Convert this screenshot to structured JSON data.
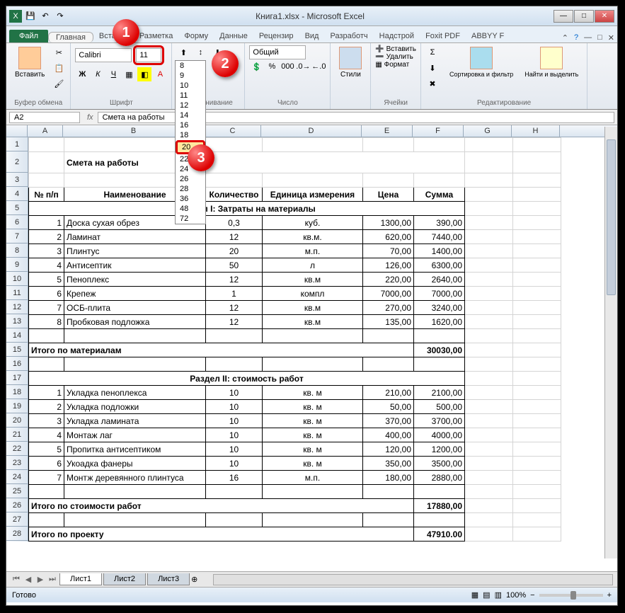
{
  "title": "Книга1.xlsx - Microsoft Excel",
  "tabs": {
    "file": "Файл",
    "home": "Главная",
    "insert": "Вставка",
    "layout": "Разметка",
    "formulas": "Форму",
    "data": "Данные",
    "review": "Рецензир",
    "view": "Вид",
    "dev": "Разработч",
    "addins": "Надстрой",
    "foxit": "Foxit PDF",
    "abbyy": "ABBYY F"
  },
  "ribbon": {
    "clipboard": {
      "label": "Буфер обмена",
      "paste": "Вставить"
    },
    "font": {
      "label": "Шрифт",
      "name": "Calibri",
      "size": "11"
    },
    "align": {
      "label": "Выравнивание"
    },
    "number": {
      "label": "Число",
      "format": "Общий"
    },
    "styles": {
      "label": "Стили"
    },
    "cells": {
      "label": "Ячейки",
      "insert": "Вставить",
      "delete": "Удалить",
      "format": "Формат"
    },
    "editing": {
      "label": "Редактирование",
      "sort": "Сортировка и фильтр",
      "find": "Найти и выделить"
    }
  },
  "font_sizes": [
    "8",
    "9",
    "10",
    "11",
    "12",
    "14",
    "16",
    "18",
    "20",
    "22",
    "24",
    "26",
    "28",
    "36",
    "48",
    "72"
  ],
  "selected_size": "20",
  "namebox": "A2",
  "formula": "Смета на работы",
  "columns": [
    "A",
    "B",
    "C",
    "D",
    "E",
    "F",
    "G",
    "H"
  ],
  "sheet": {
    "title": "Смета на работы",
    "headers": {
      "num": "№ п/п",
      "name": "Наименование",
      "qty": "Количество",
      "unit": "Единица измерения",
      "price": "Цена",
      "sum": "Сумма"
    },
    "section1": "Раздел I: Затраты на материалы",
    "section2": "Раздел II: стоимость работ",
    "rows1": [
      {
        "n": "1",
        "name": "Доска сухая обрез",
        "qty": "0,3",
        "unit": "куб.",
        "price": "1300,00",
        "sum": "390,00"
      },
      {
        "n": "2",
        "name": "Ламинат",
        "qty": "12",
        "unit": "кв.м.",
        "price": "620,00",
        "sum": "7440,00"
      },
      {
        "n": "3",
        "name": "Плинтус",
        "qty": "20",
        "unit": "м.п.",
        "price": "70,00",
        "sum": "1400,00"
      },
      {
        "n": "4",
        "name": "Антисептик",
        "qty": "50",
        "unit": "л",
        "price": "126,00",
        "sum": "6300,00"
      },
      {
        "n": "5",
        "name": "Пеноплекс",
        "qty": "12",
        "unit": "кв.м",
        "price": "220,00",
        "sum": "2640,00"
      },
      {
        "n": "6",
        "name": "Крепеж",
        "qty": "1",
        "unit": "компл",
        "price": "7000,00",
        "sum": "7000,00"
      },
      {
        "n": "7",
        "name": "ОСБ-плита",
        "qty": "12",
        "unit": "кв.м",
        "price": "270,00",
        "sum": "3240,00"
      },
      {
        "n": "8",
        "name": "Пробковая подложка",
        "qty": "12",
        "unit": "кв.м",
        "price": "135,00",
        "sum": "1620,00"
      }
    ],
    "total1_label": "Итого по материалам",
    "total1_sum": "30030,00",
    "rows2": [
      {
        "n": "1",
        "name": "Укладка пеноплекса",
        "qty": "10",
        "unit": "кв. м",
        "price": "210,00",
        "sum": "2100,00"
      },
      {
        "n": "2",
        "name": "Укладка подложки",
        "qty": "10",
        "unit": "кв. м",
        "price": "50,00",
        "sum": "500,00"
      },
      {
        "n": "3",
        "name": "Укладка  ламината",
        "qty": "10",
        "unit": "кв. м",
        "price": "370,00",
        "sum": "3700,00"
      },
      {
        "n": "4",
        "name": "Монтаж лаг",
        "qty": "10",
        "unit": "кв. м",
        "price": "400,00",
        "sum": "4000,00"
      },
      {
        "n": "5",
        "name": "Пропитка антисептиком",
        "qty": "10",
        "unit": "кв. м",
        "price": "120,00",
        "sum": "1200,00"
      },
      {
        "n": "6",
        "name": "Укоадка фанеры",
        "qty": "10",
        "unit": "кв. м",
        "price": "350,00",
        "sum": "3500,00"
      },
      {
        "n": "7",
        "name": "Монтж деревянного плинтуса",
        "qty": "16",
        "unit": "м.п.",
        "price": "180,00",
        "sum": "2880,00"
      }
    ],
    "total2_label": "Итого по стоимости работ",
    "total2_sum": "17880,00",
    "grand_label": "Итого по проекту",
    "grand_sum": "47910.00"
  },
  "sheets": {
    "s1": "Лист1",
    "s2": "Лист2",
    "s3": "Лист3"
  },
  "status": {
    "ready": "Готово",
    "zoom": "100%"
  },
  "callouts": {
    "c1": "1",
    "c2": "2",
    "c3": "3"
  }
}
